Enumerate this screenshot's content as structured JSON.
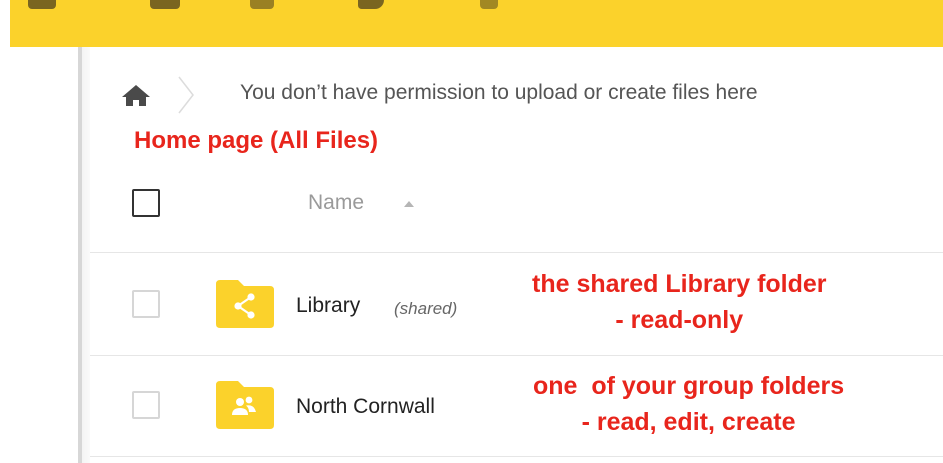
{
  "topbar": {
    "background": "#fbd22b",
    "icons": [
      "menu-icon",
      "files-icon",
      "activity-icon",
      "gallery-icon",
      "search-icon"
    ]
  },
  "breadcrumb": {
    "home_icon": "home-icon",
    "separator_icon": "chevron-right-icon",
    "permission_message": "You don’t have permission to upload or create files here"
  },
  "annotations": {
    "home_page": "Home page (All Files)",
    "library_line1": "the shared Library folder",
    "library_line2": "- read-only",
    "cornwall_line1": "one  of your group folders",
    "cornwall_line2": "- read, edit, create",
    "color": "#e8251c"
  },
  "file_list": {
    "name_header": "Name",
    "sort_icon": "sort-ascending-icon",
    "rows": [
      {
        "name": "Library",
        "tag": "(shared)",
        "icon": "shared-folder-icon"
      },
      {
        "name": "North Cornwall",
        "tag": "",
        "icon": "group-folder-icon"
      }
    ]
  },
  "colors": {
    "accent_yellow": "#fbd22b",
    "folder_yellow": "#fbd22b",
    "annotation_red": "#e8251c"
  }
}
